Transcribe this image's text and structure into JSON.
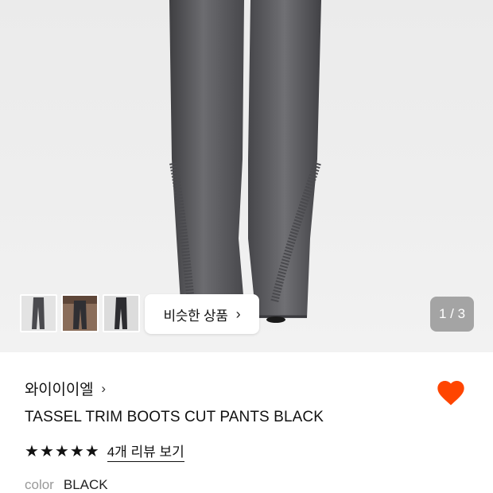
{
  "hero": {
    "similar_button_label": "비슷한 상품",
    "similar_button_chevron": "›",
    "page_indicator": "1 / 3",
    "thumbnails": [
      "thumbnail-1",
      "thumbnail-2",
      "thumbnail-3"
    ]
  },
  "product": {
    "brand": "와이이이엘",
    "brand_chevron": "›",
    "title": "TASSEL TRIM BOOTS CUT PANTS BLACK",
    "rating_stars": 5,
    "review_link": "4개 리뷰 보기",
    "option_label": "color",
    "option_value": "BLACK",
    "favorited": true
  },
  "colors": {
    "heart": "#ff4500",
    "indicator_bg": "#969696"
  },
  "icons": {
    "heart": "heart-icon",
    "star": "star-icon",
    "chevron": "chevron-right-icon"
  }
}
